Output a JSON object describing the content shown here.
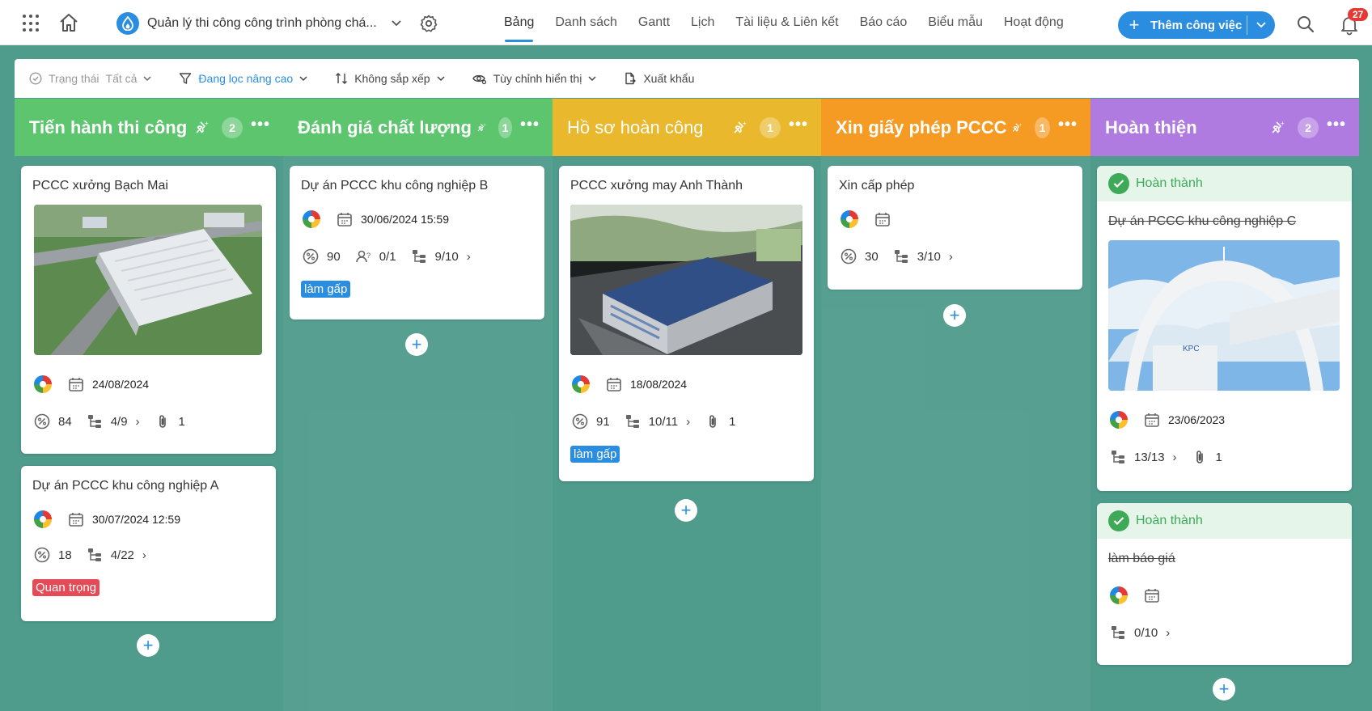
{
  "header": {
    "project_title": "Quản lý thi công công trình phòng chá...",
    "tabs": [
      "Bảng",
      "Danh sách",
      "Gantt",
      "Lịch",
      "Tài liệu & Liên kết",
      "Báo cáo",
      "Biểu mẫu",
      "Hoạt động"
    ],
    "active_tab": "Bảng",
    "add_button": "Thêm công việc",
    "notifications": "27"
  },
  "filters": {
    "status_label": "Trạng thái",
    "status_value": "Tất cả",
    "advanced": "Đang lọc nâng cao",
    "sort": "Không sắp xếp",
    "display": "Tùy chỉnh hiển thị",
    "export": "Xuất khẩu"
  },
  "columns": [
    {
      "title": "Tiến hành thi công",
      "count": "2",
      "color": "#5cc56e"
    },
    {
      "title": "Đánh giá chất lượng",
      "count": "1",
      "color": "#5cc56e"
    },
    {
      "title": "Hồ sơ hoàn công",
      "count": "1",
      "color": "#e9b82c"
    },
    {
      "title": "Xin giấy phép PCCC",
      "count": "1",
      "color": "#f59a23"
    },
    {
      "title": "Hoàn thiện",
      "count": "2",
      "color": "#b07be0"
    }
  ],
  "cards": {
    "c1": {
      "title": "PCCC xưởng Bạch Mai",
      "date": "24/08/2024",
      "progress": "84",
      "subtasks": "4/9",
      "attachments": "1"
    },
    "c2": {
      "title": "Dự án PCCC khu công nghiệp A",
      "date": "30/07/2024 12:59",
      "progress": "18",
      "subtasks": "4/22",
      "tag": "Quan trọng"
    },
    "c3": {
      "title": "Dự án PCCC khu công nghiệp B",
      "date": "30/06/2024 15:59",
      "progress": "90",
      "members": "0/1",
      "subtasks": "9/10",
      "tag": "làm gấp"
    },
    "c4": {
      "title": "PCCC xưởng may Anh Thành",
      "date": "18/08/2024",
      "progress": "91",
      "subtasks": "10/11",
      "attachments": "1",
      "tag": "làm gấp"
    },
    "c5": {
      "title": "Xin cấp phép",
      "progress": "30",
      "subtasks": "3/10"
    },
    "c6": {
      "status": "Hoàn thành",
      "title": "Dự án PCCC khu công nghiệp C",
      "date": "23/06/2023",
      "subtasks": "13/13",
      "attachments": "1"
    },
    "c7": {
      "status": "Hoàn thành",
      "title": "làm báo giá",
      "subtasks": "0/10"
    }
  }
}
